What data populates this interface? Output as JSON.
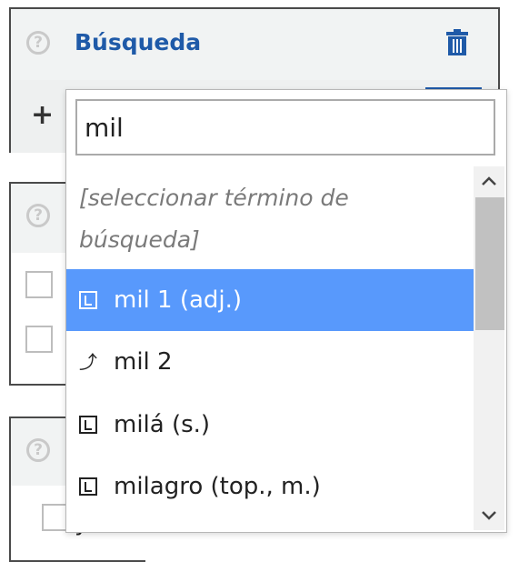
{
  "panel": {
    "title": "Búsqueda"
  },
  "background": {
    "partial_text": "y"
  },
  "dropdown": {
    "search_value": "mil",
    "placeholder_item": "[seleccionar término de búsqueda]",
    "items": [
      {
        "icon": "lexeme-icon",
        "label": "mil 1 (adj.)",
        "selected": true
      },
      {
        "icon": "redirect-icon",
        "label": "mil 2",
        "selected": false
      },
      {
        "icon": "lexeme-icon",
        "label": "milá (s.)",
        "selected": false
      },
      {
        "icon": "lexeme-icon",
        "label": "milagro (top., m.)",
        "selected": false
      }
    ],
    "scroll_position": 0.0
  },
  "colors": {
    "accent": "#1f5aa8",
    "selection": "#5899fc",
    "border": "#4a4a4a"
  }
}
